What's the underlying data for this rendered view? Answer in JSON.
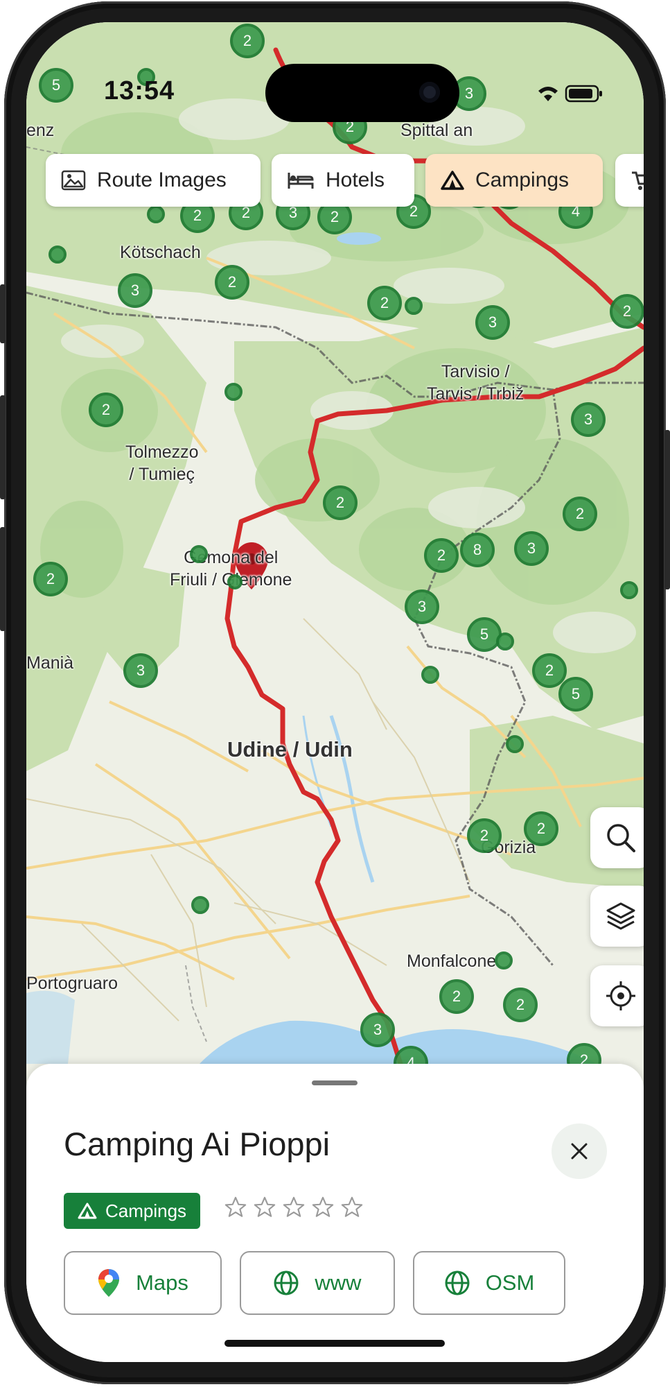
{
  "status_bar": {
    "time": "13:54"
  },
  "chips": [
    {
      "label": "Route Images",
      "icon": "image-icon"
    },
    {
      "label": "Hotels",
      "icon": "bed-icon"
    },
    {
      "label": "Campings",
      "icon": "tent-icon",
      "active": true
    }
  ],
  "map": {
    "labels": {
      "kotschach": "Kötschach",
      "spittal": "Spittal an",
      "tarvisio": "Tarvisio /\nTarvis / Trbiž",
      "tolmezzo": "Tolmezzo\n/ Tumieç",
      "gemona": "Gemona del\nFriuli / Glemone",
      "mania": "Manià",
      "udine": "Udine / Udin",
      "gorizia": "Gorizia",
      "monfalcone": "Monfalcone",
      "portogruaro": "Portogruaro",
      "enz": "enz"
    },
    "clusters": [
      "5",
      "2",
      "3",
      "2",
      "3",
      "4",
      "2",
      "2",
      "3",
      "2",
      "2",
      "4",
      "3",
      "2",
      "2",
      "3",
      "2",
      "2",
      "3",
      "2",
      "2",
      "8",
      "3",
      "2",
      "3",
      "5",
      "2",
      "5",
      "3",
      "2",
      "2",
      "2",
      "3",
      "2",
      "2",
      "4",
      "2"
    ],
    "route_color": "#d42b2b",
    "cluster_color": "#3d9a4e"
  },
  "map_controls": {
    "search": "search-icon",
    "layers": "layers-icon",
    "locate": "crosshair-icon"
  },
  "sheet": {
    "title": "Camping Ai Pioppi",
    "category": "Campings",
    "rating_stars": 0,
    "rating_max": 5,
    "actions": [
      {
        "label": "Maps",
        "icon": "google-maps-icon"
      },
      {
        "label": "www",
        "icon": "globe-icon"
      },
      {
        "label": "OSM",
        "icon": "globe-icon"
      }
    ]
  }
}
